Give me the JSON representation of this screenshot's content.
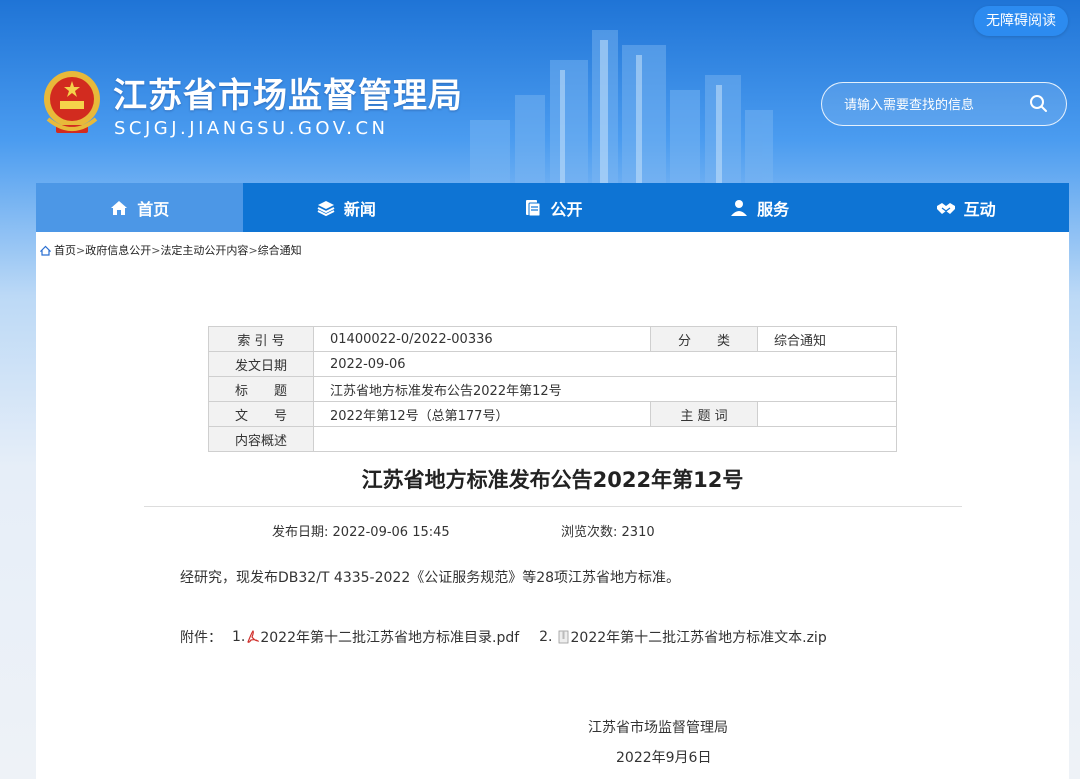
{
  "header": {
    "accessibility_label": "无障碍阅读",
    "site_title": "江苏省市场监督管理局",
    "site_domain": "SCJGJ.JIANGSU.GOV.CN",
    "search_placeholder": "请输入需要查找的信息"
  },
  "nav": {
    "items": [
      {
        "label": "首页",
        "icon": "home-icon"
      },
      {
        "label": "新闻",
        "icon": "layers-icon"
      },
      {
        "label": "公开",
        "icon": "document-icon"
      },
      {
        "label": "服务",
        "icon": "user-icon"
      },
      {
        "label": "互动",
        "icon": "handshake-icon"
      }
    ],
    "active_index": 0
  },
  "breadcrumb": [
    "首页",
    "政府信息公开",
    "法定主动公开内容",
    "综合通知"
  ],
  "meta": {
    "index_label": "索 引 号",
    "index_value": "01400022-0/2022-00336",
    "category_label": "分　　类",
    "category_value": "综合通知",
    "date_label": "发文日期",
    "date_value": "2022-09-06",
    "title_label": "标　　题",
    "title_value": "江苏省地方标准发布公告2022年第12号",
    "docno_label": "文　　号",
    "docno_value": "2022年第12号（总第177号）",
    "keywords_label": "主 题 词",
    "keywords_value": "",
    "summary_label": "内容概述",
    "summary_value": ""
  },
  "article": {
    "title": "江苏省地方标准发布公告2022年第12号",
    "publish_label": "发布日期:",
    "publish_value": "2022-09-06 15:45",
    "views_label": "浏览次数:",
    "views_value": "2310",
    "body": "经研究，现发布DB32/T 4335-2022《公证服务规范》等28项江苏省地方标准。",
    "attach_label": "附件：",
    "attachments": [
      {
        "num": "1.",
        "name": "2022年第十二批江苏省地方标准目录.pdf",
        "icon": "pdf-icon"
      },
      {
        "num": "2.",
        "name": "2022年第十二批江苏省地方标准文本.zip",
        "icon": "zip-icon"
      }
    ],
    "signature": "江苏省市场监督管理局",
    "sign_date": "2022年9月6日"
  },
  "colors": {
    "nav_bg": "#0e74d4",
    "nav_active": "#4c97e6",
    "header_blue": "#1f74d6"
  }
}
